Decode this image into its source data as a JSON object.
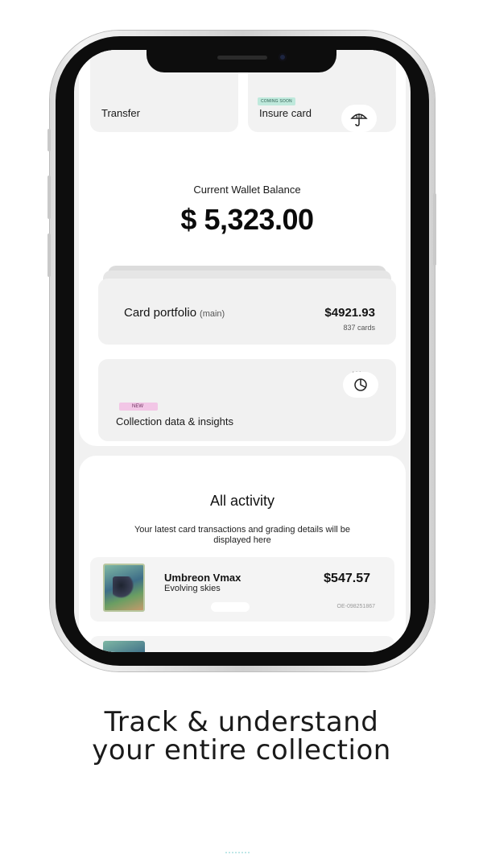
{
  "wallet": {
    "transfer_label": "Transfer",
    "insure_label": "Insure card",
    "insure_badge": "COMING SOON",
    "balance_label": "Current Wallet Balance",
    "balance_amount": "$ 5,323.00"
  },
  "portfolio": {
    "title": "Card portfolio",
    "subtitle": "(main)",
    "value": "$4921.93",
    "count": "837 cards"
  },
  "insights": {
    "badge": "NEW",
    "label": "Collection data & insights",
    "menu": "..."
  },
  "activity": {
    "title": "All activity",
    "description": "Your latest card transactions and grading details will be displayed here",
    "transactions": [
      {
        "name": "Umbreon Vmax",
        "set": "Evolving skies",
        "price": "$547.57",
        "id": "OE-098251867"
      }
    ]
  },
  "tagline": {
    "line1": "Track & understand",
    "line2": "your entire collection"
  },
  "icons": {
    "transfer": "transfer-icon",
    "insure": "umbrella-icon",
    "insights": "pie-chart-icon"
  }
}
